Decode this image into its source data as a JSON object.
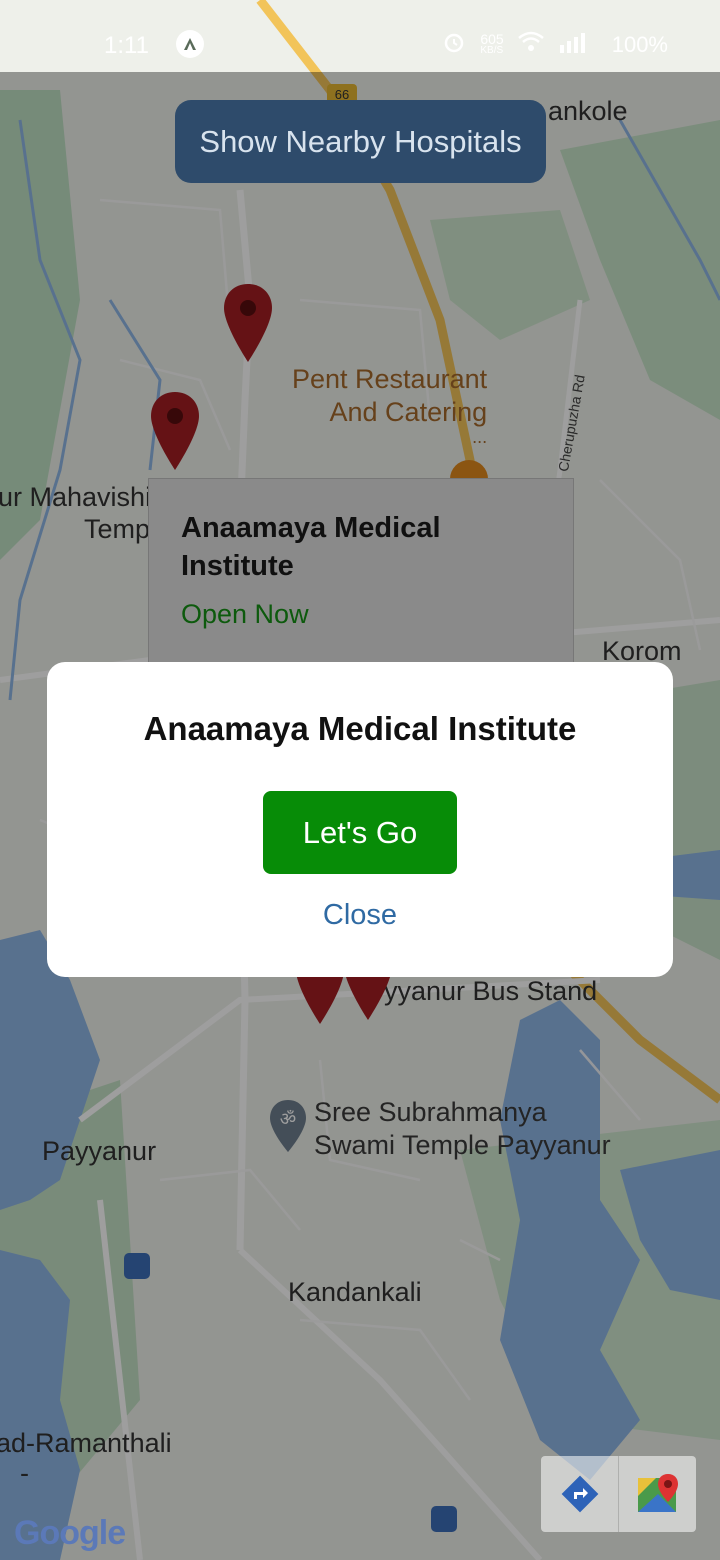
{
  "status_bar": {
    "time": "1:11",
    "speed_value": "605",
    "speed_unit": "KB/S",
    "battery": "100%"
  },
  "map": {
    "labels": {
      "top_right": "ankole",
      "left_mid": "ur Mahavishi",
      "left_mid2": "Temp",
      "korom": "Korom",
      "bus_stand": "yyanur Bus Stand",
      "payyanur": "Payyanur",
      "kandankali": "Kandankali",
      "bottom_left": "ad-Ramanthali",
      "bottom_left_dash": "-",
      "road": "Cherupuzha Rd",
      "highway_shield": "66"
    },
    "poi_restaurant": [
      "Pent Restaurant",
      "And Catering",
      "..."
    ],
    "poi_temple": [
      "Sree Subrahmanya",
      "Swami Temple Payyanur"
    ],
    "google_logo": "Google"
  },
  "top_button": {
    "label": "Show Nearby Hospitals"
  },
  "info_card": {
    "title": "Anaamaya Medical Institute",
    "status": "Open Now"
  },
  "dialog": {
    "title": "Anaamaya Medical Institute",
    "primary_label": "Let's Go",
    "secondary_label": "Close"
  },
  "colors": {
    "pin": "#a31e22",
    "button_bg": "#2e4b6b",
    "go_green": "#078c07",
    "close_blue": "#2f6aa3",
    "open_green": "#0d5a0d"
  },
  "icons": [
    "alarm-icon",
    "wifi-icon",
    "signal-icon",
    "battery-icon",
    "directions-icon",
    "google-maps-icon",
    "transit-icon",
    "temple-icon",
    "restaurant-icon"
  ]
}
